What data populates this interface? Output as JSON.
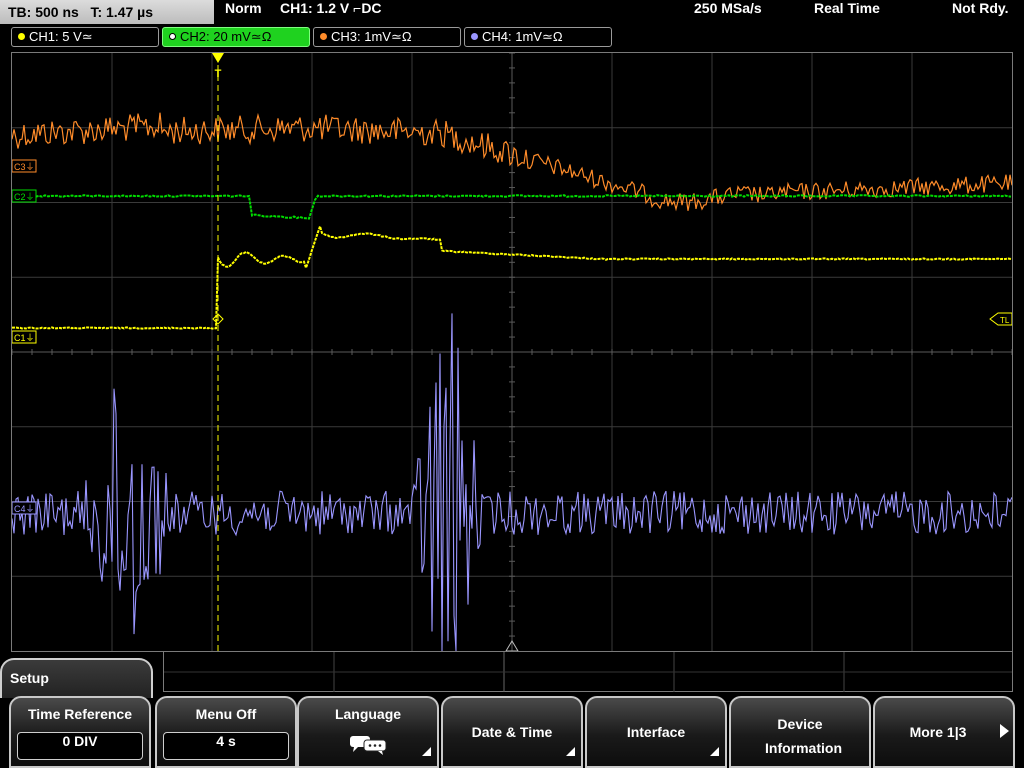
{
  "status_bar": {
    "timebase": "TB: 500 ns   T: 1.47 µs",
    "trigger_mode": "Norm",
    "trigger_setting": "CH1: 1.2 V ⌐DC",
    "sample_rate": "250 MSa/s",
    "acq_mode": "Real Time",
    "status": "Not Rdy."
  },
  "channels": [
    {
      "label": "CH1: 5 V≃",
      "color": "#ffff00",
      "active": false
    },
    {
      "label": "CH2: 20 mV≃Ω",
      "color": "#00dd00",
      "active": true
    },
    {
      "label": "CH3: 1mV≃Ω",
      "color": "#ff8c2a",
      "active": false
    },
    {
      "label": "CH4: 1mV≃Ω",
      "color": "#9a96ff",
      "active": false
    }
  ],
  "markers": {
    "c3": "C3⏚",
    "c2": "C2⏚",
    "c1": "C1⏚",
    "c4": "C4⏚",
    "trigger_level": "TL",
    "trigger_pos": "T"
  },
  "menu": {
    "title": "Setup",
    "buttons": [
      {
        "label": "Time Reference",
        "value": "0 DIV"
      },
      {
        "label": "Menu Off",
        "value": "4 s"
      },
      {
        "label": "Language",
        "icon": "speech-bubbles-icon"
      },
      {
        "label": "Date & Time"
      },
      {
        "label": "Interface"
      },
      {
        "label": "Device Information"
      },
      {
        "label": "More 1|3"
      }
    ]
  }
}
